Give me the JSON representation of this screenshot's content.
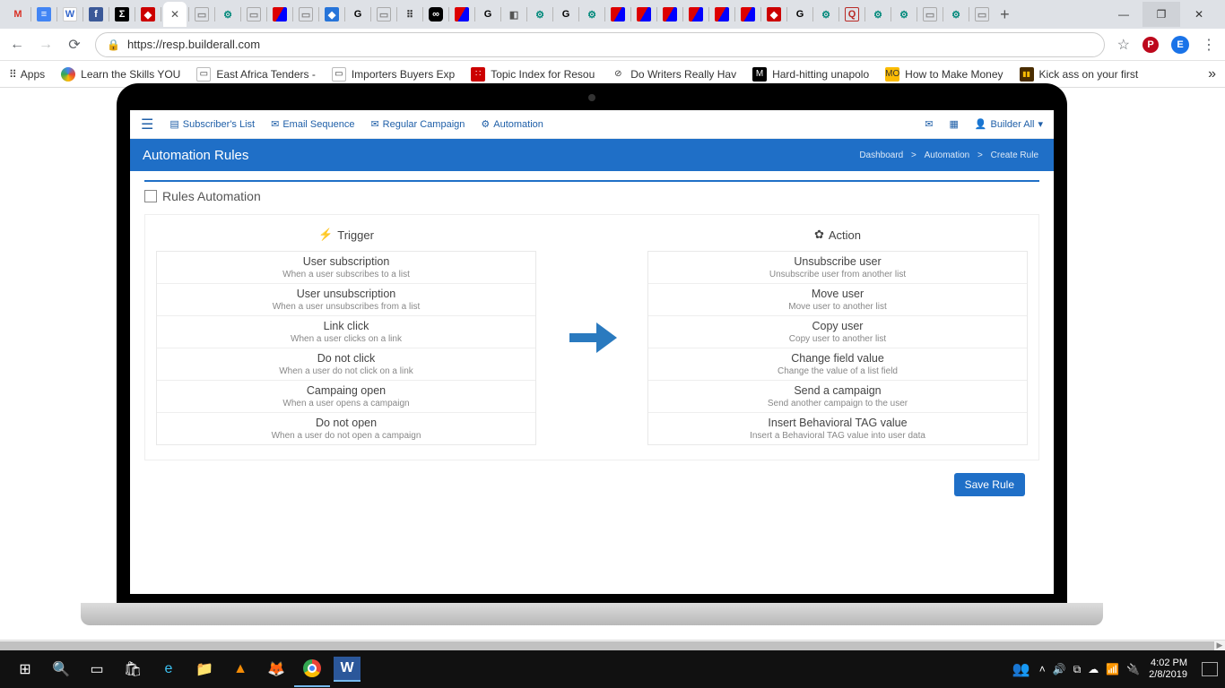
{
  "browser": {
    "url": "https://resp.builderall.com",
    "avatar_letter": "E",
    "new_tab": "+",
    "close_tab": "✕",
    "minimize": "—",
    "maximize": "❐",
    "close": "✕"
  },
  "bookmarks": {
    "apps": "Apps",
    "items": [
      "Learn the Skills YOU ",
      "East Africa Tenders - ",
      "Importers Buyers Exp",
      "Topic Index for Resou",
      "Do Writers Really Hav",
      "Hard-hitting unapolo",
      "How to Make Money",
      "Kick ass on your first "
    ],
    "more": "»"
  },
  "app": {
    "nav": {
      "subscribers": "Subscriber's List",
      "sequence": "Email Sequence",
      "campaign": "Regular Campaign",
      "automation": "Automation",
      "user": "Builder All"
    },
    "header": {
      "title": "Automation Rules",
      "crumb1": "Dashboard",
      "crumb2": "Automation",
      "crumb3": "Create Rule",
      "sep": ">"
    },
    "section_title": "Rules Automation",
    "cols": {
      "trigger_label": "Trigger",
      "action_label": "Action"
    },
    "triggers": [
      {
        "t": "User subscription",
        "d": "When a user subscribes to a list"
      },
      {
        "t": "User unsubscription",
        "d": "When a user unsubscribes from a list"
      },
      {
        "t": "Link click",
        "d": "When a user clicks on a link"
      },
      {
        "t": "Do not click",
        "d": "When a user do not click on a link"
      },
      {
        "t": "Campaing open",
        "d": "When a user opens a campaign"
      },
      {
        "t": "Do not open",
        "d": "When a user do not open a campaign"
      }
    ],
    "actions": [
      {
        "t": "Unsubscribe user",
        "d": "Unsubscribe user from another list"
      },
      {
        "t": "Move user",
        "d": "Move user to another list"
      },
      {
        "t": "Copy user",
        "d": "Copy user to another list"
      },
      {
        "t": "Change field value",
        "d": "Change the value of a list field"
      },
      {
        "t": "Send a campaign",
        "d": "Send another campaign to the user"
      },
      {
        "t": "Insert Behavioral TAG value",
        "d": "Insert a Behavioral TAG value into user data"
      }
    ],
    "save_button": "Save Rule"
  },
  "taskbar": {
    "time": "4:02 PM",
    "date": "2/8/2019"
  }
}
